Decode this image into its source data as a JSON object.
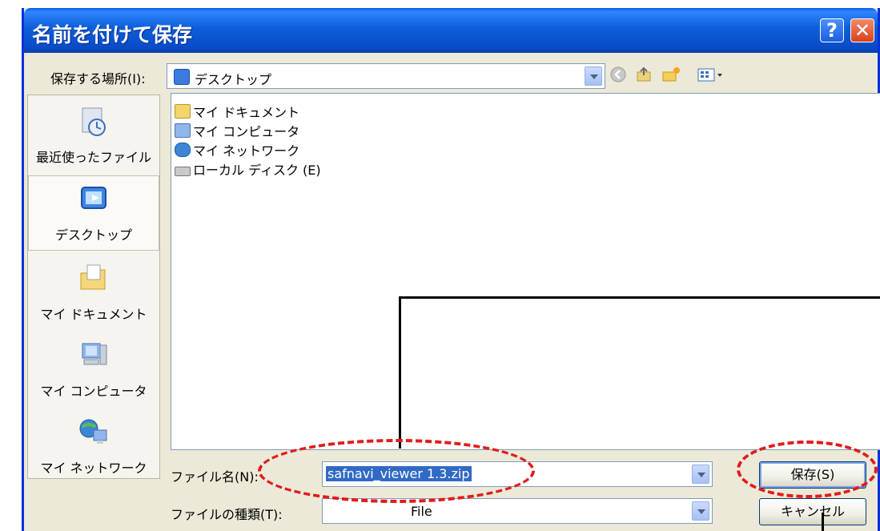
{
  "dialog": {
    "title": "名前を付けて保存",
    "help_label": "?",
    "close_label": "✕"
  },
  "location": {
    "label": "保存する場所(I):",
    "value": "デスクトップ"
  },
  "toolbar": {
    "icons": [
      "back-icon",
      "up-folder-icon",
      "new-folder-icon",
      "view-menu-icon"
    ]
  },
  "places": [
    {
      "label": "最近使ったファイル",
      "icon": "recent-icon"
    },
    {
      "label": "デスクトップ",
      "icon": "desktop-icon"
    },
    {
      "label": "マイ ドキュメント",
      "icon": "my-documents-icon"
    },
    {
      "label": "マイ コンピュータ",
      "icon": "my-computer-icon"
    },
    {
      "label": "マイ ネットワーク",
      "icon": "my-network-icon"
    }
  ],
  "files": [
    {
      "label": "マイ ドキュメント",
      "icon": "folder-icon"
    },
    {
      "label": "マイ コンピュータ",
      "icon": "computer-icon"
    },
    {
      "label": "マイ ネットワーク",
      "icon": "network-icon"
    },
    {
      "label": "ローカル ディスク (E)",
      "icon": "drive-icon"
    }
  ],
  "filename": {
    "label": "ファイル名(N):",
    "value": "safnavi_viewer 1.3.zip"
  },
  "filetype": {
    "label": "ファイルの種類(T):",
    "value": "File"
  },
  "buttons": {
    "save": "保存(S)",
    "cancel": "キャンセル"
  },
  "colors": {
    "annotation": "#e21b1b",
    "titlebar": "#0a4dc9",
    "selection": "#316ac5"
  }
}
